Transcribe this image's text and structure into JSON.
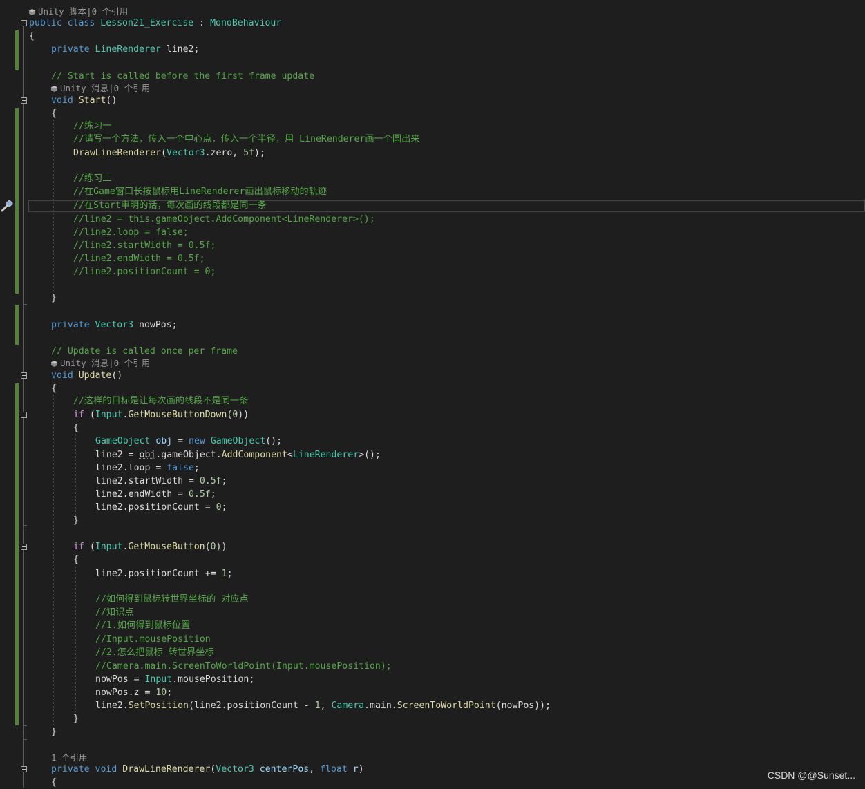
{
  "codelens": {
    "class_refs": "Unity 脚本|0 个引用",
    "start_refs": "Unity 消息|0 个引用",
    "update_refs": "Unity 消息|0 个引用",
    "draw_refs": "1 个引用"
  },
  "code": {
    "class_decl": {
      "kw1": "public",
      "kw2": "class",
      "name": "Lesson21_Exercise",
      "sep": " : ",
      "base": "MonoBehaviour"
    },
    "open_brace": "{",
    "close_brace": "}",
    "field_line2": {
      "kw": "private",
      "type": "LineRenderer",
      "rest": " line2;"
    },
    "comment_start": "// Start is called before the first frame update",
    "start_decl": {
      "kw": "void",
      "name": "Start",
      "rest": "()"
    },
    "start_body": {
      "c1": "//练习一",
      "c2": "//请写一个方法，传入一个中心点，传入一个半径，用 LineRenderer画一个圆出来",
      "draw_call": {
        "name": "DrawLineRenderer",
        "p1": "(",
        "type": "Vector3",
        "p2": ".zero, ",
        "num": "5f",
        "p3": ");"
      },
      "c3": "//练习二",
      "c4": "//在Game窗口长按鼠标用LineRenderer画出鼠标移动的轨迹",
      "c5": "//在Start申明的话，每次画的线段都是同一条",
      "c6": "//line2 = this.gameObject.AddComponent<LineRenderer>();",
      "c7": "//line2.loop = false;",
      "c8": "//line2.startWidth = 0.5f;",
      "c9": "//line2.endWidth = 0.5f;",
      "c10": "//line2.positionCount = 0;"
    },
    "field_nowpos": {
      "kw": "private",
      "type": "Vector3",
      "rest": " nowPos;"
    },
    "comment_update": "// Update is called once per frame",
    "update_decl": {
      "kw": "void",
      "name": "Update",
      "rest": "()"
    },
    "update_body": {
      "c1": "//这样的目标是让每次画的线段不是同一条",
      "if1": {
        "kw": "if",
        "p1": " (",
        "type": "Input",
        "p2": ".",
        "fn": "GetMouseButtonDown",
        "p3": "(",
        "num": "0",
        "p4": "))"
      },
      "go_line": {
        "type1": "GameObject",
        "var": "obj",
        "eq": " = ",
        "kw": "new",
        "type2": "GameObject",
        "rest": "();"
      },
      "add_line": {
        "a": "line2 = ",
        "obj": "obj",
        "b": ".gameObject.",
        "fn": "AddComponent",
        "c": "<",
        "type": "LineRenderer",
        "d": ">();"
      },
      "loop_line": {
        "a": "line2.loop = ",
        "kw": "false",
        "b": ";"
      },
      "sw_line": {
        "a": "line2.startWidth = ",
        "num": "0.5f",
        "b": ";"
      },
      "ew_line": {
        "a": "line2.endWidth = ",
        "num": "0.5f",
        "b": ";"
      },
      "pc_line": {
        "a": "line2.positionCount = ",
        "num": "0",
        "b": ";"
      },
      "if2": {
        "kw": "if",
        "p1": " (",
        "type": "Input",
        "p2": ".",
        "fn": "GetMouseButton",
        "p3": "(",
        "num": "0",
        "p4": "))"
      },
      "inc_line": {
        "a": "line2.positionCount += ",
        "num": "1",
        "b": ";"
      },
      "k1": "//如何得到鼠标转世界坐标的 对应点",
      "k2": "//知识点",
      "k3": "//1.如何得到鼠标位置",
      "k4": "//Input.mousePosition",
      "k5": "//2.怎么把鼠标 转世界坐标",
      "k6": "//Camera.main.ScreenToWorldPoint(Input.mousePosition);",
      "np_line": {
        "a": "nowPos = ",
        "type": "Input",
        "b": ".mousePosition;"
      },
      "npz_line": {
        "a": "nowPos.z = ",
        "num": "10",
        "b": ";"
      },
      "set_line": {
        "a": "line2.",
        "fn": "SetPosition",
        "b": "(line2.positionCount - ",
        "num": "1",
        "c": ", ",
        "type": "Camera",
        "d": ".main.",
        "fn2": "ScreenToWorldPoint",
        "e": "(nowPos));"
      }
    },
    "draw_decl": {
      "kw1": "private",
      "kw2": "void",
      "name": "DrawLineRenderer",
      "p1": "(",
      "type": "Vector3",
      "var1": "centerPos",
      "c": ", ",
      "kw3": "float",
      "var2": "r",
      "p2": ")"
    }
  },
  "watermark": "CSDN @@Sunset...",
  "colors": {
    "background": "#1e1e1e",
    "keyword": "#569cd6",
    "type": "#4ec9b0",
    "method": "#dcdcaa",
    "comment": "#57a64a",
    "number": "#b5cea8",
    "control": "#d8a0df",
    "parameter": "#9cdcfe",
    "change_bar": "#56813a"
  },
  "icons": [
    "unity-cube-icon",
    "fold-minus-icon",
    "screwdriver-lightbulb-icon"
  ]
}
